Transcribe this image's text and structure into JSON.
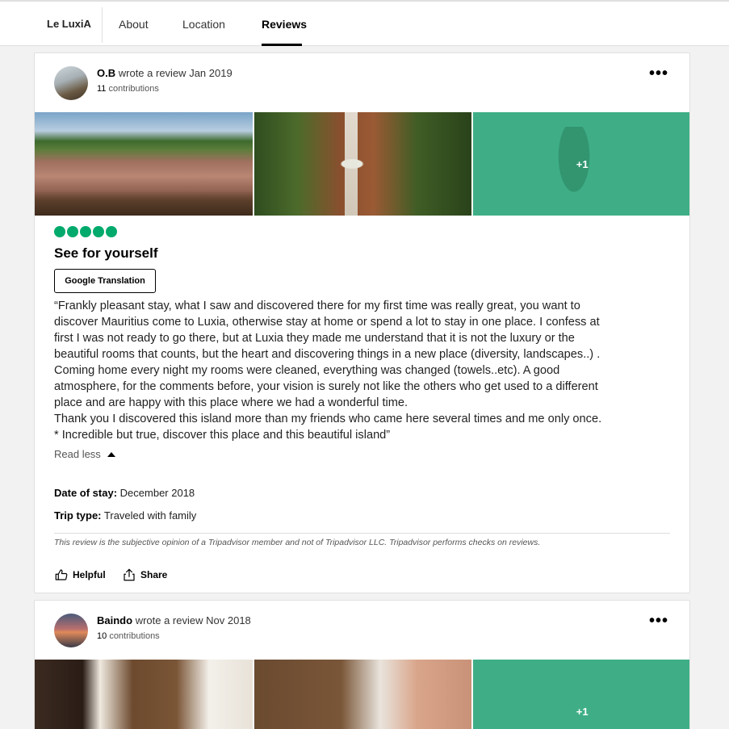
{
  "nav": {
    "brand": "Le LuxiA",
    "tabs": [
      "About",
      "Location",
      "Reviews"
    ],
    "active_tab": "Reviews"
  },
  "reviews": [
    {
      "author": "O.B",
      "action": "wrote a review",
      "date": "Jan 2019",
      "contributions_count": "11",
      "contributions_label": "contributions",
      "more_label": "•••",
      "photo_more": "+1",
      "rating": 5,
      "title": "See for yourself",
      "translation_button": "Google Translation",
      "body_lines": [
        "“Frankly pleasant stay, what I saw and discovered there for my first time was really great, you want to",
        "discover Mauritius come to Luxia, otherwise stay at home or spend a lot to stay in one place. I confess at",
        "first I was not ready to go there, but at Luxia they made me understand that it is not the luxury or the",
        "beautiful rooms that counts, but the heart and discovering things in a new place (diversity, landscapes..) .",
        "Coming home every night my rooms were cleaned, everything was changed (towels..etc). A good",
        "atmosphere, for the comments before, your vision is surely not like the others who get used to a different",
        "place and are happy with this place where we had a wonderful time.",
        "Thank you I discovered this island more than my friends who came here several times and me only once.",
        "* Incredible but true, discover this place and this beautiful island”"
      ],
      "read_less": "Read less",
      "date_of_stay_label": "Date of stay:",
      "date_of_stay": "December 2018",
      "trip_type_label": "Trip type:",
      "trip_type": "Traveled with family",
      "disclaimer": "This review is the subjective opinion of a Tripadvisor member and not of Tripadvisor LLC. Tripadvisor performs checks on reviews.",
      "helpful_label": "Helpful",
      "share_label": "Share"
    },
    {
      "author": "Baindo",
      "action": "wrote a review",
      "date": "Nov 2018",
      "contributions_count": "10",
      "contributions_label": "contributions",
      "more_label": "•••",
      "photo_more": "+1"
    }
  ],
  "colors": {
    "rating_bubble": "#00aa6c",
    "photo_overlay": "#3fae86"
  }
}
